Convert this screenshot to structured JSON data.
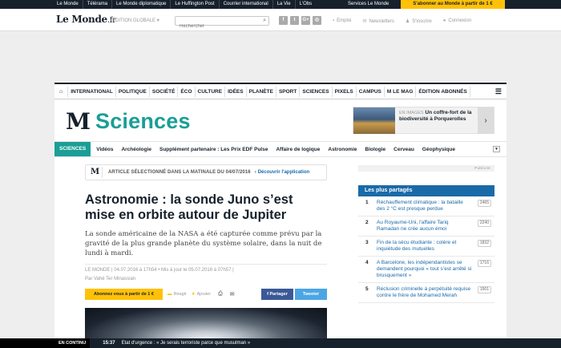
{
  "topbar": {
    "links": [
      "Le Monde",
      "Télérama",
      "Le Monde diplomatique",
      "Le Huffington Post",
      "Courrier international",
      "La Vie",
      "L'Obs"
    ],
    "services": "Services Le Monde",
    "subscribe": "S'abonner au Monde à partir de 1 €"
  },
  "header": {
    "logo": "Le Monde",
    "logo_suffix": ".fr",
    "edition": "ÉDITION GLOBALE",
    "edition_caret": "▾",
    "search_placeholder": "Rechercher",
    "socials": [
      "f",
      "t",
      "G+",
      "◎"
    ],
    "links": {
      "emploi": "Emploi",
      "newsletters": "Newsletters",
      "inscrire": "S'inscrire",
      "connexion": "Connexion"
    }
  },
  "nav": {
    "items": [
      "INTERNATIONAL",
      "POLITIQUE",
      "SOCIÉTÉ",
      "ÉCO",
      "CULTURE",
      "IDÉES",
      "PLANÈTE",
      "SPORT",
      "SCIENCES",
      "PIXELS",
      "CAMPUS",
      "M LE MAG",
      "ÉDITION ABONNÉS"
    ]
  },
  "section": {
    "logo": "M",
    "title": "Sciences"
  },
  "promo": {
    "label": "EN IMAGES",
    "text": "Un coffre-fort de la biodiversité à Porquerolles",
    "arrow": "›"
  },
  "subnav": {
    "active": "SCIENCES",
    "items": [
      "Vidéos",
      "Archéologie",
      "Supplément partenaire : Les Prix EDF Pulse",
      "Affaire de logique",
      "Astronomie",
      "Biologie",
      "Cerveau",
      "Géophysique"
    ],
    "more": "▾"
  },
  "article": {
    "badge_logo": "M",
    "badge_text": "ARTICLE SÉLECTIONNÉ DANS LA MATINALE DU 04/07/2016",
    "download": "Découvrir l'application",
    "title": "Astronomie : la sonde Juno s’est mise en orbite autour de Jupiter",
    "chapo": "La sonde américaine de la NASA a été capturée comme prévu par la gravité de la plus grande planète du système solaire, dans la nuit de lundi à mardi.",
    "source": "LE MONDE",
    "dates": " | 04.07.2016 à 17h54 • Mis à jour le 05.07.2016 à 07h57 |",
    "author": "Par Vahé Ter Minassian",
    "subscribe": "Abonnez vous à partir de 1 €",
    "react": "Réagir",
    "add": "Ajouter",
    "share_fb": "f Partager",
    "share_tw": "Tweeter"
  },
  "sidebar": {
    "pub": "Publicité",
    "shared_title": "Les plus partagés",
    "shared": [
      {
        "n": "1",
        "text": "Réchauffement climatique : la bataille des 2 °C est presque perdue",
        "count": "2465"
      },
      {
        "n": "2",
        "text": "Au Royaume-Uni, l'affaire Tariq Ramadan ne crée aucun émoi",
        "count": "2240"
      },
      {
        "n": "3",
        "text": "Fin de la sécu étudiante : colère et inquiétude des mutuelles",
        "count": "1832"
      },
      {
        "n": "4",
        "text": "A Barcelone, les indépendantistes se demandent pourquoi « tout s’est arrêté si brusquement »",
        "count": "1716"
      },
      {
        "n": "5",
        "text": "Réclusion criminelle à perpétuité requise contre le frère de Mohamed Merah",
        "count": "1501"
      }
    ]
  },
  "ticker": {
    "label": "EN CONTINU",
    "time": "15:37",
    "text": "Etat d'urgence : « Je serais terroriste parce que musulman »"
  }
}
